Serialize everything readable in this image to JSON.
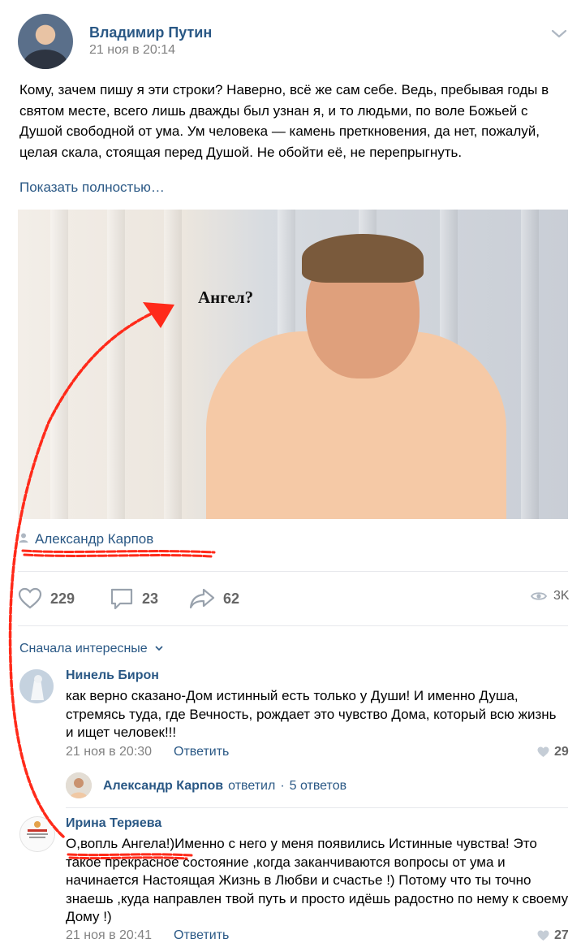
{
  "post": {
    "author": "Владимир Путин",
    "date": "21 ноя в 20:14",
    "text": "Кому, зачем пишу я эти строки? Наверно, всё же сам себе. Ведь, пребывая годы в святом месте, всего лишь дважды был узнан я, и то людьми, по воле Божьей с Душой свободной от ума. Ум человека — камень преткновения, да нет, пожалуй, целая скала, стоящая перед Душой. Не обойти её, не перепрыгнуть.",
    "show_more": "Показать полностью…",
    "photo_label": "Ангел?",
    "photo_author": "Александр Карпов"
  },
  "actions": {
    "likes": "229",
    "comments": "23",
    "shares": "62",
    "views": "3K"
  },
  "comments_sort": "Сначала интересные",
  "comments": [
    {
      "author": "Нинель Бирон",
      "text": "как верно сказано-Дом истинный есть только у Души! И именно Душа, стремясь туда, где Вечность, рождает это чувство Дома, который всю жизнь и ищет человек!!!",
      "date": "21 ноя в 20:30",
      "reply": "Ответить",
      "likes": "29",
      "thread": {
        "author": "Александр Карпов",
        "verb": "ответил",
        "separator": "·",
        "count": "5 ответов"
      }
    },
    {
      "author": "Ирина Теряева",
      "text": "О,вопль Ангела!)Именно с него у меня появились Истинные чувства! Это такое прекрасное состояние ,когда заканчиваются вопросы от ума и начинается Настоящая Жизнь в Любви и счастье !) Потому что ты точно знаешь ,куда направлен твой путь и просто идёшь радостно по нему к своему Дому !)",
      "date": "21 ноя в 20:41",
      "reply": "Ответить",
      "likes": "27"
    }
  ],
  "colors": {
    "link": "#2a5885",
    "meta": "#828282",
    "annotation": "#ff2a1a"
  }
}
